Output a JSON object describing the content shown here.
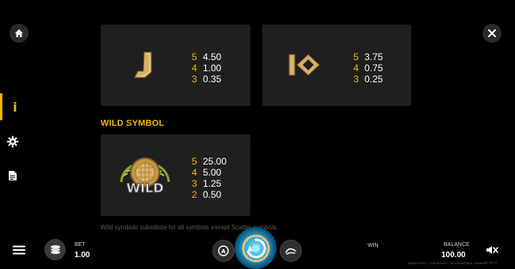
{
  "nav": {
    "home_icon": "home-icon",
    "close_icon": "close-icon",
    "rail": [
      {
        "name": "info",
        "icon": "info-icon",
        "glyph": "i",
        "active": true
      },
      {
        "name": "settings",
        "icon": "gear-icon",
        "active": false
      },
      {
        "name": "rules",
        "icon": "document-icon",
        "active": false
      }
    ],
    "menu_icon": "hamburger-icon"
  },
  "paytable": {
    "cards": [
      {
        "symbol_glyph": "J",
        "pays": [
          {
            "count": "5",
            "value": "4.50"
          },
          {
            "count": "4",
            "value": "1.00"
          },
          {
            "count": "3",
            "value": "0.35"
          }
        ]
      },
      {
        "symbol_glyph": "IO",
        "pays": [
          {
            "count": "5",
            "value": "3.75"
          },
          {
            "count": "4",
            "value": "0.75"
          },
          {
            "count": "3",
            "value": "0.25"
          }
        ]
      }
    ],
    "wild": {
      "title": "WILD SYMBOL",
      "symbol_text": "WILD",
      "pays": [
        {
          "count": "5",
          "value": "25.00"
        },
        {
          "count": "4",
          "value": "5.00"
        },
        {
          "count": "3",
          "value": "1.25"
        },
        {
          "count": "2",
          "value": "0.50"
        }
      ],
      "description": "Wild symbols substitute for all symbols except Scatter symbols."
    }
  },
  "bottom": {
    "bet_label": "BET",
    "bet_value": "1.00",
    "win_label": "WIN",
    "balance_label": "BALANCE",
    "balance_value": "100.00",
    "fine_print": "DEMO PLAY | FUN MONEY | RESPONSIBLE GAMING",
    "time_text": "21:31:17",
    "accent_color": "#f2b705"
  }
}
